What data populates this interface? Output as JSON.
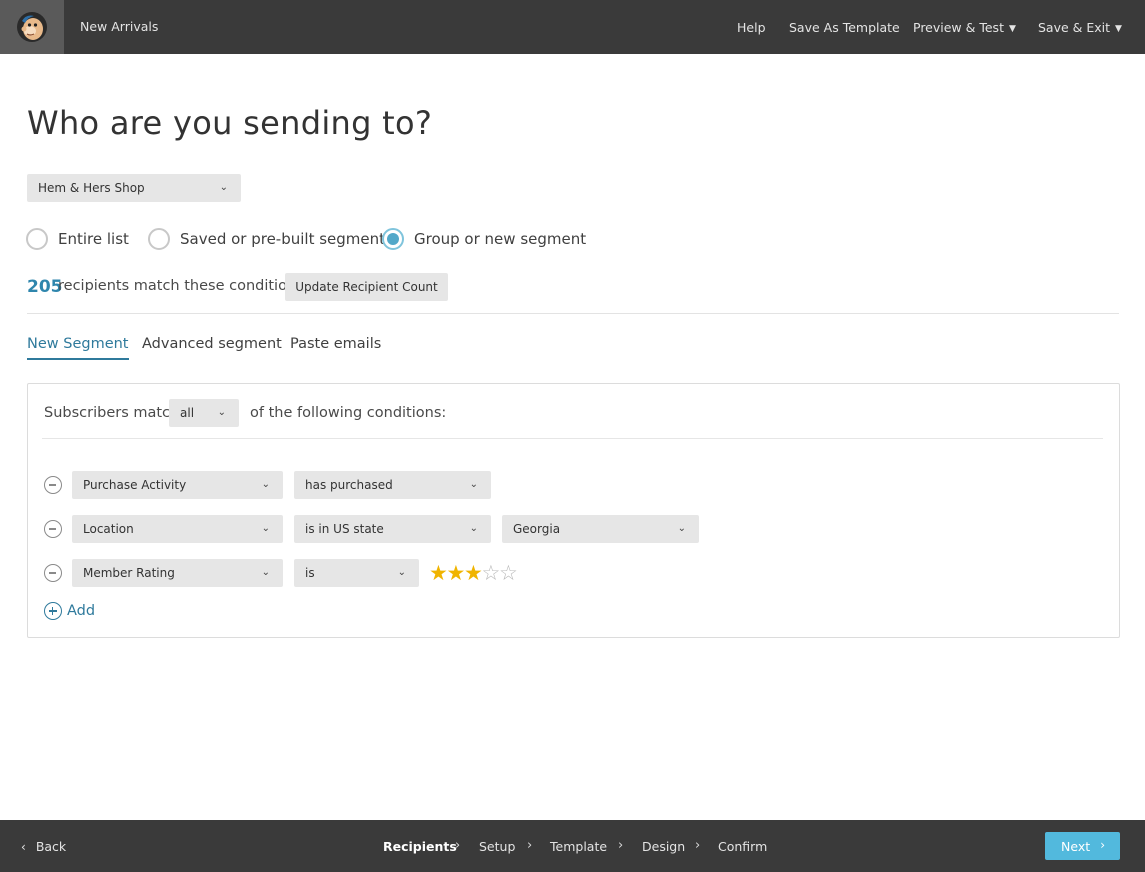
{
  "header": {
    "campaign_name": "New Arrivals",
    "links": {
      "help": "Help",
      "save_template": "Save As Template",
      "preview_test": "Preview & Test",
      "save_exit": "Save & Exit"
    }
  },
  "page": {
    "title": "Who are you sending to?"
  },
  "list_select": {
    "value": "Hem & Hers Shop"
  },
  "recipient_options": [
    {
      "label": "Entire list",
      "selected": false
    },
    {
      "label": "Saved or pre-built segment",
      "selected": false
    },
    {
      "label": "Group or new segment",
      "selected": true
    }
  ],
  "recipient_count": {
    "number": "205",
    "text": "recipients match these conditions.",
    "update_button": "Update Recipient Count"
  },
  "tabs": [
    {
      "label": "New Segment",
      "active": true
    },
    {
      "label": "Advanced segment",
      "active": false
    },
    {
      "label": "Paste emails",
      "active": false
    }
  ],
  "segment": {
    "match_label": "Subscribers match",
    "match_value": "all",
    "match_suffix": "of the following conditions:",
    "conditions": [
      {
        "field": "Purchase Activity",
        "operator": "has purchased"
      },
      {
        "field": "Location",
        "operator": "is in US state",
        "value": "Georgia"
      },
      {
        "field": "Member Rating",
        "operator": "is",
        "rating": 3,
        "rating_max": 5
      }
    ],
    "add_label": "Add"
  },
  "footer": {
    "back_label": "Back",
    "steps": [
      "Recipients",
      "Setup",
      "Template",
      "Design",
      "Confirm"
    ],
    "current_step": "Recipients",
    "next_label": "Next"
  },
  "colors": {
    "topbar": "#3a3a3a",
    "accent": "#2f7a9c",
    "next_button": "#52b9dd",
    "star": "#f0b400"
  }
}
